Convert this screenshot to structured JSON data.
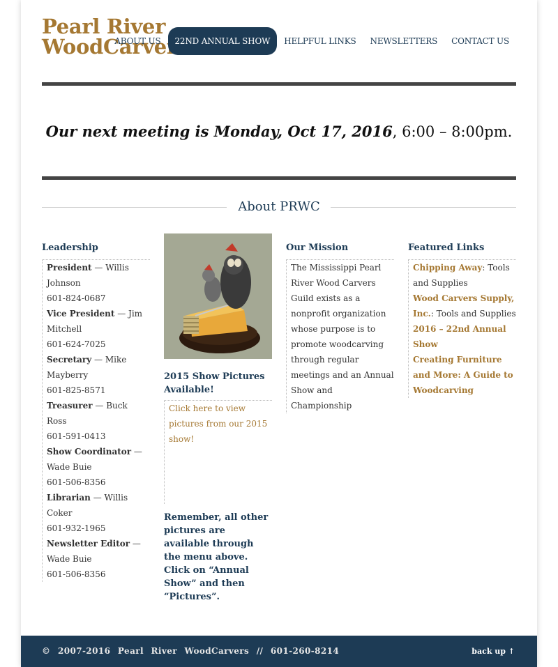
{
  "site": {
    "logo_line1": "Pearl River",
    "logo_line2": "WoodCarvers"
  },
  "nav": [
    {
      "label": "ABOUT US",
      "active": false
    },
    {
      "label": "22ND ANNUAL SHOW",
      "active": true
    },
    {
      "label": "HELPFUL LINKS",
      "active": false
    },
    {
      "label": "NEWSLETTERS",
      "active": false
    },
    {
      "label": "CONTACT US",
      "active": false
    }
  ],
  "meeting": {
    "bold_italic": "Our next meeting is Monday, Oct 17, 2016",
    "rest": ", 6:00 – 8:00pm."
  },
  "about_title": "About PRWC",
  "leadership": {
    "title": "Leadership",
    "roles": [
      {
        "role": "President",
        "name": " — Willis Johnson",
        "phone": "601-824-0687"
      },
      {
        "role": "Vice President",
        "name": " — Jim Mitchell",
        "phone": "601-624-7025"
      },
      {
        "role": "Secretary",
        "name": " — Mike Mayberry",
        "phone": "601-825-8571"
      },
      {
        "role": "Treasurer",
        "name": " — Buck Ross",
        "phone": "601-591-0413"
      },
      {
        "role": "Show Coordinator",
        "name": " — Wade Buie",
        "phone": "601-506-8356"
      },
      {
        "role": "Librarian",
        "name": " — Willis Coker",
        "phone": "601-932-1965"
      },
      {
        "role": "Newsletter Editor",
        "name": " — Wade Buie",
        "phone": "601-506-8356"
      }
    ]
  },
  "show_pictures": {
    "title": "2015 Show Pictures Available!",
    "link": "Click here to view pictures from our 2015 show!",
    "note": "Remember, all other pictures are available through the menu above. Click on “Annual Show” and then “Pictures”."
  },
  "mission": {
    "title": "Our Mission",
    "text": "The Mississippi Pearl River Wood Carvers Guild exists as a nonprofit organization whose purpose is to promote woodcarving through regular meetings and an Annual Show and Championship"
  },
  "featured": {
    "title": "Featured Links",
    "items": [
      {
        "link": "Chipping Away",
        "desc": ": Tools and Supplies"
      },
      {
        "link": "Wood Carvers Supply, Inc.",
        "desc": ": Tools and Supplies"
      },
      {
        "link": "2016 – 22nd Annual Show",
        "desc": ""
      },
      {
        "link": "Creating Furniture and More: A Guide to Woodcarving",
        "desc": ""
      }
    ]
  },
  "footer": {
    "copyright": "© 2007-2016 Pearl River WoodCarvers // 601-260-8214",
    "back_up": "back up ↑"
  }
}
